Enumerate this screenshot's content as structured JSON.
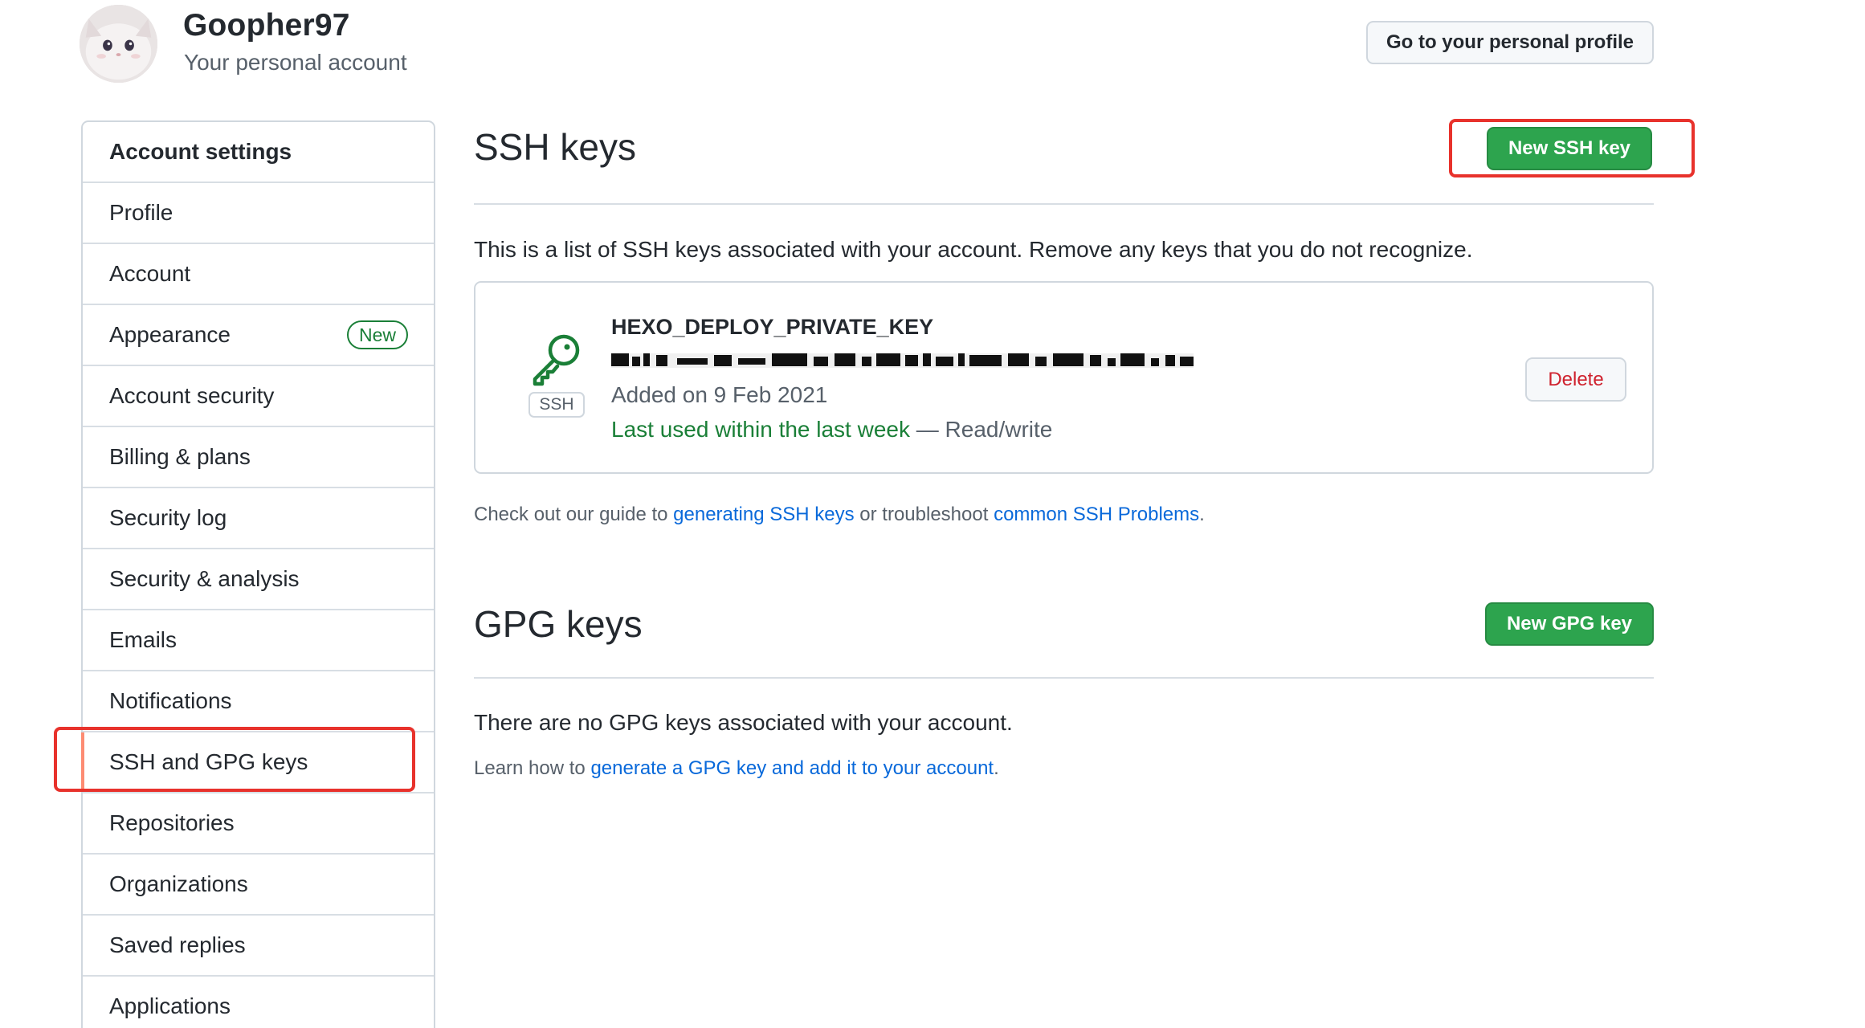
{
  "header": {
    "username": "Goopher97",
    "account_type": "Your personal account",
    "profile_button": "Go to your personal profile"
  },
  "sidebar": {
    "heading": "Account settings",
    "items": [
      {
        "label": "Profile"
      },
      {
        "label": "Account"
      },
      {
        "label": "Appearance",
        "badge": "New"
      },
      {
        "label": "Account security"
      },
      {
        "label": "Billing & plans"
      },
      {
        "label": "Security log"
      },
      {
        "label": "Security & analysis"
      },
      {
        "label": "Emails"
      },
      {
        "label": "Notifications"
      },
      {
        "label": "SSH and GPG keys",
        "selected": true
      },
      {
        "label": "Repositories"
      },
      {
        "label": "Organizations"
      },
      {
        "label": "Saved replies"
      },
      {
        "label": "Applications"
      }
    ]
  },
  "ssh": {
    "title": "SSH keys",
    "new_button": "New SSH key",
    "description": "This is a list of SSH keys associated with your account. Remove any keys that you do not recognize.",
    "keys": [
      {
        "icon": "key-icon",
        "type_label": "SSH",
        "name": "HEXO_DEPLOY_PRIVATE_KEY",
        "added": "Added on 9 Feb 2021",
        "last_used": "Last used within the last week",
        "separator": " — ",
        "access": "Read/write",
        "delete_button": "Delete"
      }
    ],
    "guide": {
      "prefix": "Check out our guide to ",
      "link1": "generating SSH keys",
      "middle": " or troubleshoot ",
      "link2": "common SSH Problems",
      "suffix": "."
    }
  },
  "gpg": {
    "title": "GPG keys",
    "new_button": "New GPG key",
    "empty_text": "There are no GPG keys associated with your account.",
    "learn": {
      "prefix": "Learn how to ",
      "link": "generate a GPG key and add it to your account",
      "suffix": "."
    }
  },
  "colors": {
    "accent_green": "#2da44e",
    "danger_red": "#cf222e",
    "link_blue": "#0969da",
    "selection_bar": "#fd8c73",
    "highlight_box": "#e8322c"
  }
}
